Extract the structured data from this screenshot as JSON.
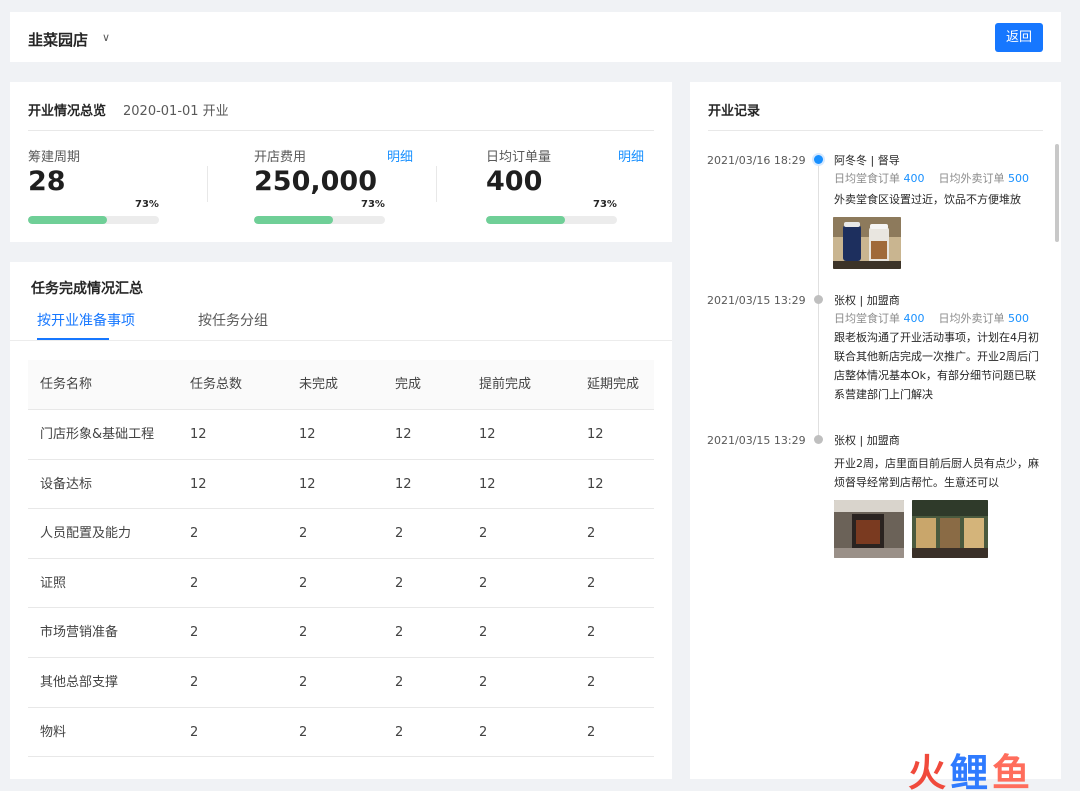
{
  "header": {
    "store_name": "韭菜园店",
    "back_label": "返回"
  },
  "overview": {
    "title": "开业情况总览",
    "open_date": "2020-01-01 开业",
    "metrics": [
      {
        "label": "筹建周期",
        "value": "28",
        "percent": "73%",
        "progress": 0.6,
        "link": ""
      },
      {
        "label": "开店费用",
        "value": "250,000",
        "percent": "73%",
        "progress": 0.6,
        "link": "明细"
      },
      {
        "label": "日均订单量",
        "value": "400",
        "percent": "73%",
        "progress": 0.6,
        "link": "明细"
      }
    ]
  },
  "tasks": {
    "title": "任务完成情况汇总",
    "tabs": [
      "按开业准备事项",
      "按任务分组"
    ],
    "columns": [
      "任务名称",
      "任务总数",
      "未完成",
      "完成",
      "提前完成",
      "延期完成"
    ],
    "rows": [
      [
        "门店形象&基础工程",
        "12",
        "12",
        "12",
        "12",
        "12"
      ],
      [
        "设备达标",
        "12",
        "12",
        "12",
        "12",
        "12"
      ],
      [
        "人员配置及能力",
        "2",
        "2",
        "2",
        "2",
        "2"
      ],
      [
        "证照",
        "2",
        "2",
        "2",
        "2",
        "2"
      ],
      [
        "市场营销准备",
        "2",
        "2",
        "2",
        "2",
        "2"
      ],
      [
        "其他总部支撑",
        "2",
        "2",
        "2",
        "2",
        "2"
      ],
      [
        "物料",
        "2",
        "2",
        "2",
        "2",
        "2"
      ]
    ]
  },
  "records": {
    "title": "开业记录",
    "entries": [
      {
        "time": "2021/03/16  18:29",
        "user": "阿冬冬 | 督导",
        "dine_label": "日均堂食订单",
        "dine_value": "400",
        "takeout_label": "日均外卖订单",
        "takeout_value": "500",
        "text": "外卖堂食区设置过近，饮品不方便堆放"
      },
      {
        "time": "2021/03/15  13:29",
        "user": "张权 | 加盟商",
        "dine_label": "日均堂食订单",
        "dine_value": "400",
        "takeout_label": "日均外卖订单",
        "takeout_value": "500",
        "text": "跟老板沟通了开业活动事项，计划在4月初联合其他新店完成一次推广。开业2周后门店整体情况基本Ok，有部分细节问题已联系营建部门上门解决"
      },
      {
        "time": "2021/03/15  13:29",
        "user": "张权 | 加盟商",
        "text": "开业2周，店里面目前后厨人员有点少，麻烦督导经常到店帮忙。生意还可以"
      }
    ]
  },
  "watermark": {
    "part1": "火",
    "part2": "鲤",
    "part3": "鱼"
  },
  "colors": {
    "primary": "#1677ff",
    "progress": "#6fcf97",
    "link": "#1890ff"
  }
}
